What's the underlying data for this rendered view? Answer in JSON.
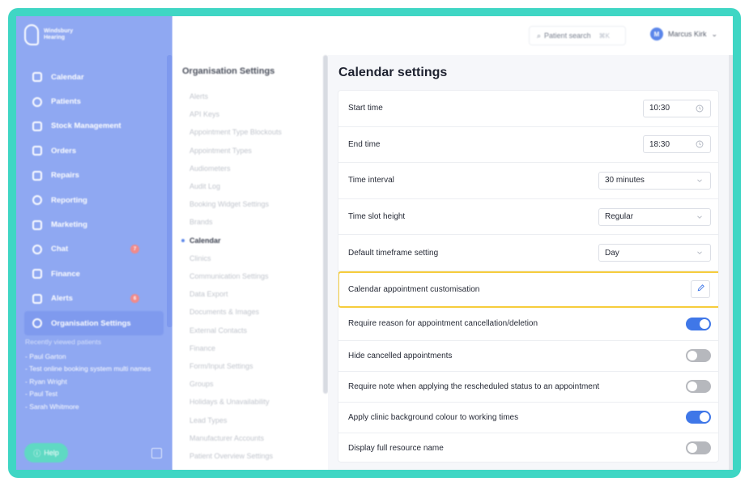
{
  "brand": {
    "line1": "Windsbury",
    "line2": "Hearing"
  },
  "nav": [
    {
      "label": "Calendar",
      "icon": "calendar-icon"
    },
    {
      "label": "Patients",
      "icon": "patients-icon"
    },
    {
      "label": "Stock Management",
      "icon": "stock-icon"
    },
    {
      "label": "Orders",
      "icon": "orders-icon"
    },
    {
      "label": "Repairs",
      "icon": "wrench-icon"
    },
    {
      "label": "Reporting",
      "icon": "reporting-icon"
    },
    {
      "label": "Marketing",
      "icon": "mail-icon"
    },
    {
      "label": "Chat",
      "icon": "chat-icon",
      "badge": "7"
    },
    {
      "label": "Finance",
      "icon": "finance-icon"
    },
    {
      "label": "Alerts",
      "icon": "bell-icon",
      "badge": "6"
    },
    {
      "label": "Organisation Settings",
      "icon": "gear-icon"
    }
  ],
  "recent": {
    "heading": "Recently viewed patients",
    "items": [
      "- Paul Garton",
      "- Test online booking system multi names",
      "- Ryan Wright",
      "- Paul Test",
      "- Sarah Whitmore"
    ]
  },
  "help": {
    "label": "Help"
  },
  "topbar": {
    "search_label": "Patient search",
    "search_shortcut": "⌘K",
    "user_initial": "M",
    "user_name": "Marcus Kirk"
  },
  "submenu": {
    "title": "Organisation Settings",
    "items": [
      "Alerts",
      "API Keys",
      "Appointment Type Blockouts",
      "Appointment Types",
      "Audiometers",
      "Audit Log",
      "Booking Widget Settings",
      "Brands",
      "Calendar",
      "Clinics",
      "Communication Settings",
      "Data Export",
      "Documents & Images",
      "External Contacts",
      "Finance",
      "Form/Input Settings",
      "Groups",
      "Holidays & Unavailability",
      "Lead Types",
      "Manufacturer Accounts",
      "Patient Overview Settings"
    ],
    "active": "Calendar"
  },
  "main": {
    "title": "Calendar settings",
    "rows": [
      {
        "label": "Start time",
        "type": "time",
        "value": "10:30"
      },
      {
        "label": "End time",
        "type": "time",
        "value": "18:30"
      },
      {
        "label": "Time interval",
        "type": "select",
        "value": "30 minutes"
      },
      {
        "label": "Time slot height",
        "type": "select",
        "value": "Regular"
      },
      {
        "label": "Default timeframe setting",
        "type": "select",
        "value": "Day"
      },
      {
        "label": "Calendar appointment customisation",
        "type": "edit"
      },
      {
        "label": "Require reason for appointment cancellation/deletion",
        "type": "toggle",
        "on": true
      },
      {
        "label": "Hide cancelled appointments",
        "type": "toggle",
        "on": false
      },
      {
        "label": "Require note when applying the rescheduled status to an appointment",
        "type": "toggle",
        "on": false
      },
      {
        "label": "Apply clinic background colour to working times",
        "type": "toggle",
        "on": true
      },
      {
        "label": "Display full resource name",
        "type": "toggle",
        "on": false
      }
    ]
  },
  "colors": {
    "accent": "#3f77e8",
    "sidebar": "#8fa8f2",
    "highlight": "#f6cd3c",
    "frame": "#3fd6c4"
  }
}
